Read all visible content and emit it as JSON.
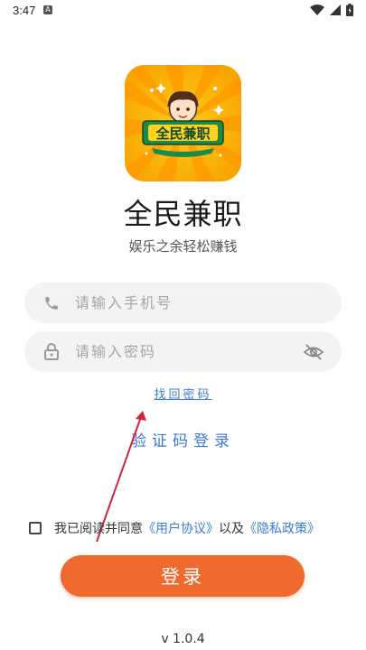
{
  "status_bar": {
    "time": "3:47",
    "notification_letter": "A"
  },
  "app": {
    "logo_text": "全民兼职",
    "name": "全民兼职",
    "slogan": "娱乐之余轻松赚钱"
  },
  "form": {
    "phone_placeholder": "请输入手机号",
    "password_placeholder": "请输入密码",
    "forgot_password": "找回密码",
    "code_login": "验证码登录"
  },
  "agreement": {
    "prefix": "我已阅读并同意",
    "user_agreement": "《用户协议》",
    "and": "以及",
    "privacy_policy": "《隐私政策》",
    "checked": false
  },
  "login_button": "登录",
  "version": "v 1.0.4",
  "colors": {
    "accent": "#f06a2d",
    "link": "#3a7bd5",
    "annotation": "#d0243a"
  }
}
